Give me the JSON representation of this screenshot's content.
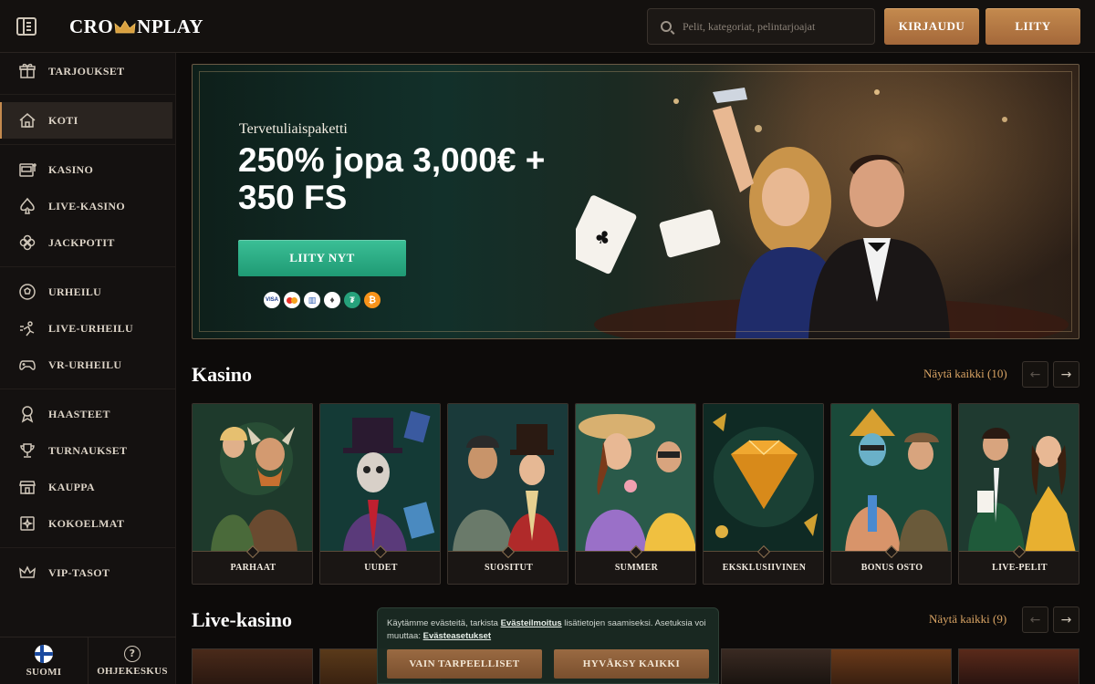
{
  "header": {
    "logo_left": "CRO",
    "logo_right": "NPLAY",
    "search_placeholder": "Pelit, kategoriat, pelintarjoajat",
    "login_label": "KIRJAUDU",
    "join_label": "LIITY"
  },
  "sidebar": {
    "items": [
      {
        "label": "TARJOUKSET",
        "icon": "gift-icon"
      },
      {
        "label": "KOTI",
        "icon": "home-icon",
        "active": true
      },
      {
        "label": "KASINO",
        "icon": "slot-machine-icon"
      },
      {
        "label": "LIVE-KASINO",
        "icon": "spade-icon"
      },
      {
        "label": "JACKPOTIT",
        "icon": "clover-icon"
      },
      {
        "label": "URHEILU",
        "icon": "football-icon"
      },
      {
        "label": "LIVE-URHEILU",
        "icon": "live-sport-icon"
      },
      {
        "label": "VR-URHEILU",
        "icon": "gamepad-icon"
      },
      {
        "label": "HAASTEET",
        "icon": "ribbon-icon"
      },
      {
        "label": "TURNAUKSET",
        "icon": "trophy-icon"
      },
      {
        "label": "KAUPPA",
        "icon": "shop-icon"
      },
      {
        "label": "KOKOELMAT",
        "icon": "cards-icon"
      },
      {
        "label": "VIP-TASOT",
        "icon": "crown-icon"
      }
    ],
    "footer": {
      "language_label": "SUOMI",
      "help_label": "OHJEKESKUS"
    }
  },
  "hero": {
    "subtitle": "Tervetuliaispaketti",
    "title": "250% jopa 3,000€ + 350 FS",
    "cta_label": "LIITY NYT",
    "payment_methods": [
      "VISA",
      "Mastercard",
      "Bank",
      "Ethereum",
      "Tether",
      "Bitcoin"
    ]
  },
  "casino": {
    "title": "Kasino",
    "see_all": "Näytä kaikki (10)",
    "categories": [
      "PARHAAT",
      "UUDET",
      "SUOSITUT",
      "SUMMER",
      "EKSKLUSIIVINEN",
      "BONUS OSTO",
      "LIVE-PELIT"
    ]
  },
  "live_casino": {
    "title": "Live-kasino",
    "see_all": "Näytä kaikki (9)"
  },
  "cookie": {
    "text_1": "Käytämme evästeitä, tarkista ",
    "link_policy": "Evästeilmoitus",
    "text_2": " lisätietojen saamiseksi. Asetuksia voi muuttaa: ",
    "link_settings": "Evästeasetukset",
    "necessary_label": "VAIN TARPEELLISET",
    "accept_label": "HYVÄKSY KAIKKI"
  },
  "colors": {
    "accent_gold": "#c48a4e",
    "cta_green": "#2aae85",
    "background": "#0d0b0a"
  }
}
